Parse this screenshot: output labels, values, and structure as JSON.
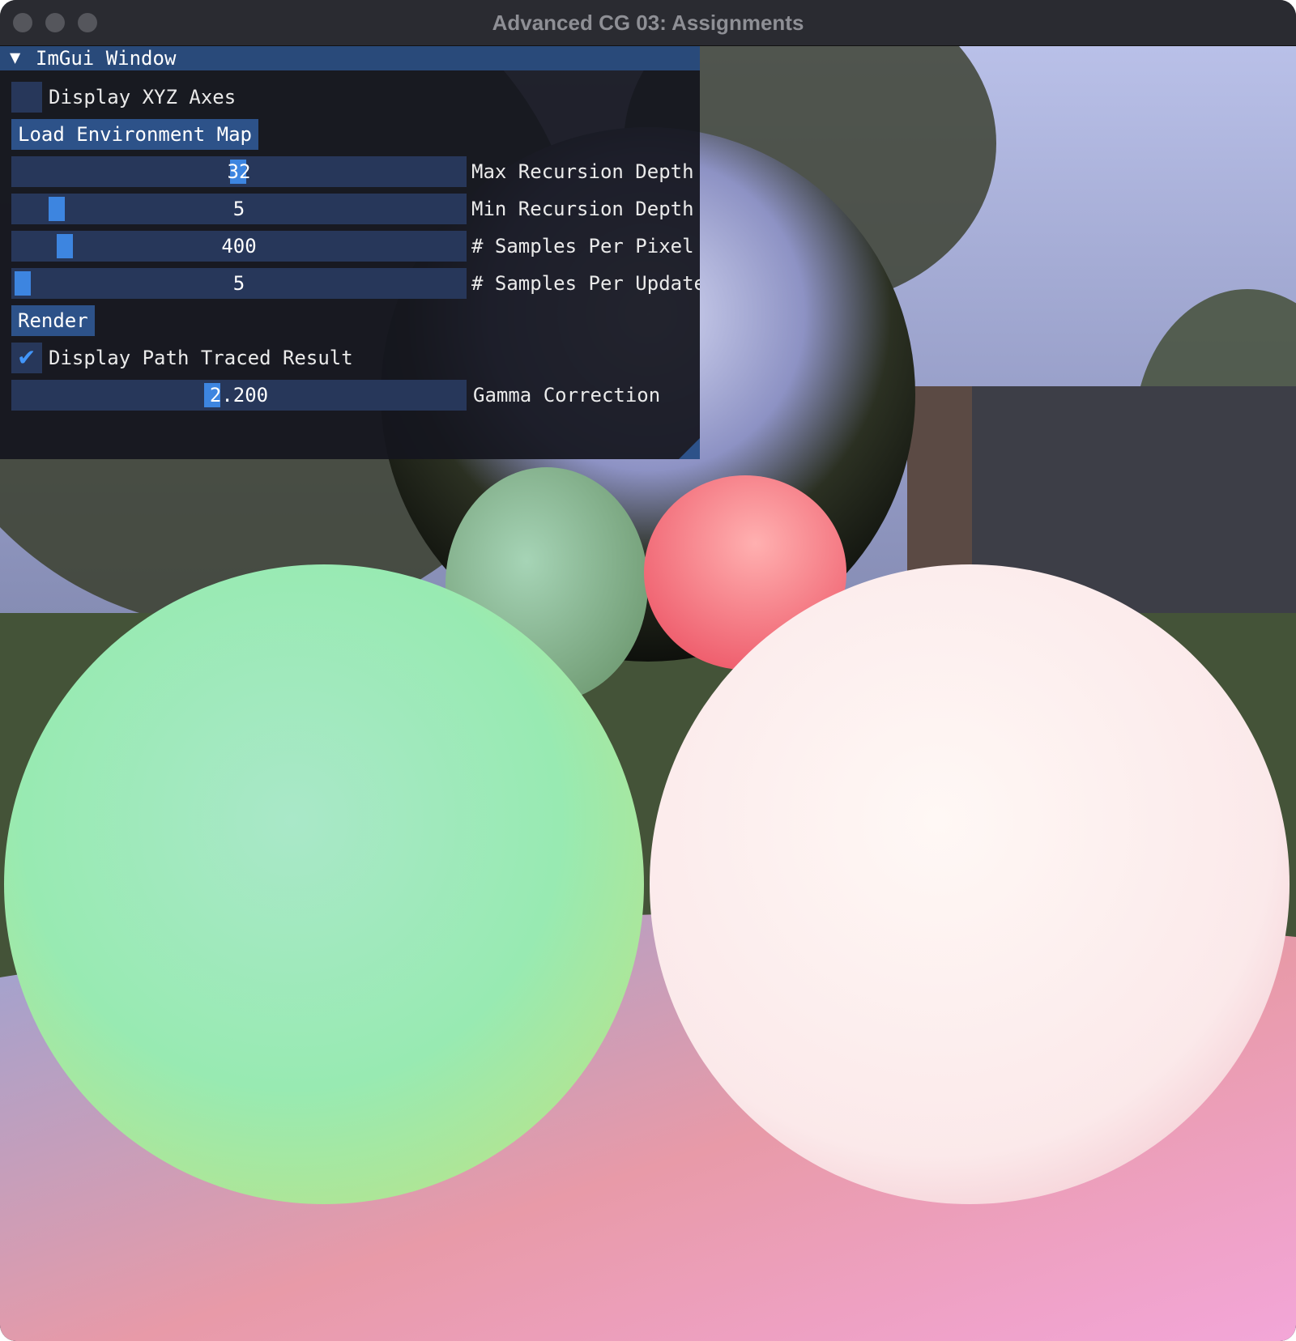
{
  "window": {
    "title": "Advanced CG 03: Assignments"
  },
  "imgui": {
    "title": "ImGui Window",
    "display_axes": {
      "label": "Display XYZ Axes",
      "checked": false
    },
    "load_env_button": "Load Environment Map",
    "sliders": [
      {
        "value": "32",
        "label": "Max Recursion Depth",
        "fraction": 0.5
      },
      {
        "value": "5",
        "label": "Min Recursion Depth",
        "fraction": 0.09
      },
      {
        "value": "400",
        "label": "# Samples Per Pixel",
        "fraction": 0.11
      },
      {
        "value": "5",
        "label": "# Samples Per Update",
        "fraction": 0.01
      }
    ],
    "render_button": "Render",
    "display_path_traced": {
      "label": "Display Path Traced Result",
      "checked": true
    },
    "gamma": {
      "value": "2.200",
      "label": "Gamma Correction",
      "fraction": 0.44
    }
  },
  "colors": {
    "accent": "#4296fa",
    "title_bar": "#294a7a",
    "frame_bg": "#27375a",
    "button": "#2d5289",
    "slider_grab": "#3d85e0"
  },
  "icons": {
    "collapse": "triangle-down-icon",
    "check": "checkmark-icon",
    "resize": "resize-grip-icon"
  }
}
